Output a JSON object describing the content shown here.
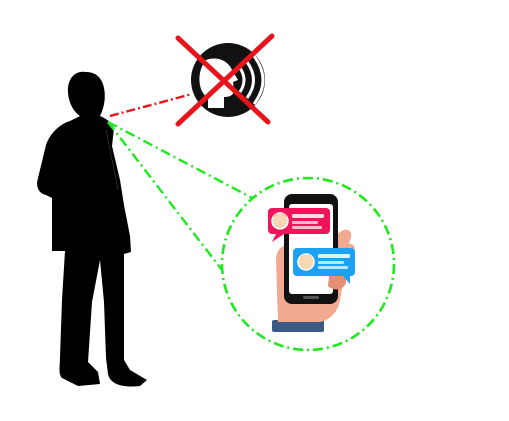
{
  "colors": {
    "background": "#ffffff",
    "silhouette": "#000000",
    "cross": "#e8141b",
    "voice_line": "#e8141b",
    "chat_line": "#1ee81e",
    "chat_circle": "#1ee81e",
    "phone_body": "#111111",
    "phone_screen": "#ffffff",
    "hand_skin": "#f2a98f",
    "hand_skin_dark": "#e58f75",
    "sleeve": "#3b5b85",
    "bubble_incoming": "#f0145a",
    "bubble_outgoing": "#1da1f2",
    "avatar_face": "#f7d7b5"
  },
  "icons": {
    "speaking": "speaking-head-icon",
    "prohibited": "red-cross-icon",
    "messaging": "phone-chat-icon"
  }
}
